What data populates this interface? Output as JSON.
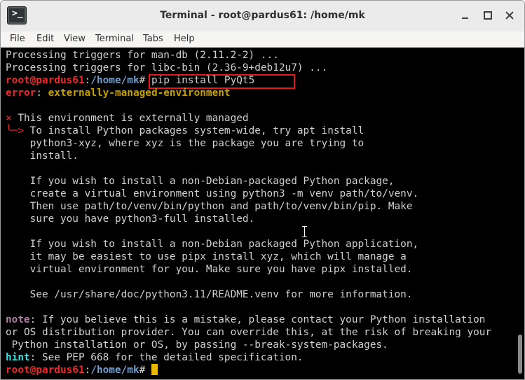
{
  "window": {
    "title": "Terminal - root@pardus61: /home/mk",
    "icon_glyph": ">_"
  },
  "menu": [
    "File",
    "Edit",
    "View",
    "Terminal",
    "Tabs",
    "Help"
  ],
  "colors": {
    "prompt_user": "#ef2929",
    "prompt_path": "#729fcf",
    "error": "#ef2929",
    "yellow": "#c4a000",
    "note": "#ad7fa8",
    "hint": "#34e2e2",
    "cursor": "#e8b800",
    "annotation_box": "#e51a1a"
  },
  "terminal": {
    "prompt_user": "root@pardus61",
    "prompt_sep": ":",
    "prompt_path": "/home/mk",
    "prompt_end": "# ",
    "lines": {
      "l1": "Processing triggers for man-db (2.11.2-2) ...",
      "l2": "Processing triggers for libc-bin (2.36-9+deb12u7) ...",
      "cmd": "pip install PyQt5",
      "err_label": "error",
      "err_colon": ": ",
      "err_text": "externally-managed-environment",
      "x_mark": "×",
      "env_managed": " This environment is externally managed",
      "arrow": "╰─>",
      "m1": " To install Python packages system-wide, try apt install",
      "m2": "    python3-xyz, where xyz is the package you are trying to",
      "m3": "    install.",
      "m4": "    If you wish to install a non-Debian-packaged Python package,",
      "m5": "    create a virtual environment using python3 -m venv path/to/venv.",
      "m6": "    Then use path/to/venv/bin/python and path/to/venv/bin/pip. Make",
      "m7": "    sure you have python3-full installed.",
      "m8": "    If you wish to install a non-Debian packaged Python application,",
      "m9": "    it may be easiest to use pipx install xyz, which will manage a",
      "m10": "    virtual environment for you. Make sure you have pipx installed.",
      "m11": "    See /usr/share/doc/python3.11/README.venv for more information.",
      "note_label": "note",
      "n1": ": If you believe this is a mistake, please contact your Python installation",
      "n2": "or OS distribution provider. You can override this, at the risk of breaking your",
      "n3": " Python installation or OS, by passing --break-system-packages.",
      "hint_label": "hint",
      "h1": ": See PEP 668 for the detailed specification."
    }
  }
}
